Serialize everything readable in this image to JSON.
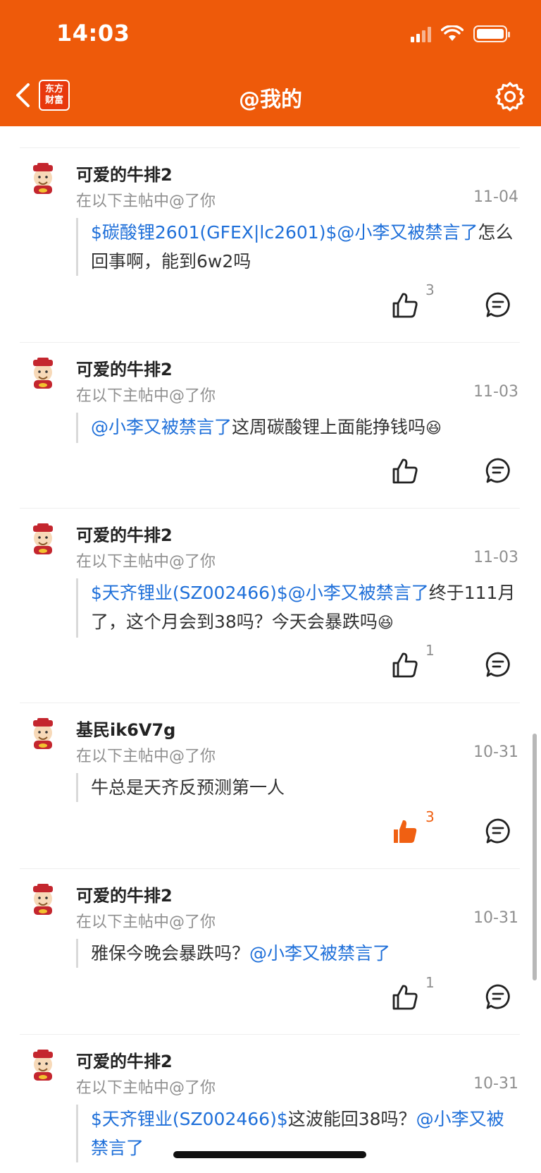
{
  "status_bar": {
    "time": "14:03"
  },
  "header": {
    "title": "@我的",
    "logo_line1": "东方",
    "logo_line2": "财富"
  },
  "colors": {
    "brand": "#EE5A0A",
    "link": "#1E6FD9",
    "like_active": "#F06012"
  },
  "items": [
    {
      "username": "可爱的牛排2",
      "subline": "在以下主帖中@了你",
      "date": "11-04",
      "link_a": "$碳酸锂2601(GFEX|lc2601)$@小李又被禁言了",
      "text_a": "怎么回事啊，能到6w2吗",
      "link_b": "",
      "text_b": "",
      "emoji": "",
      "likes": "3",
      "liked": false
    },
    {
      "username": "可爱的牛排2",
      "subline": "在以下主帖中@了你",
      "date": "11-03",
      "link_a": "@小李又被禁言了",
      "text_a": "这周碳酸锂上面能挣钱吗",
      "link_b": "",
      "text_b": "",
      "emoji": "😆",
      "likes": "",
      "liked": false
    },
    {
      "username": "可爱的牛排2",
      "subline": "在以下主帖中@了你",
      "date": "11-03",
      "link_a": "$天齐锂业(SZ002466)$@小李又被禁言了",
      "text_a": "终于111月了，这个月会到38吗？今天会暴跌吗",
      "link_b": "",
      "text_b": "",
      "emoji": "😆",
      "likes": "1",
      "liked": false
    },
    {
      "username": "基民ik6V7g",
      "subline": "在以下主帖中@了你",
      "date": "10-31",
      "link_a": "",
      "text_a": "牛总是天齐反预测第一人",
      "link_b": "",
      "text_b": "",
      "emoji": "",
      "likes": "3",
      "liked": true
    },
    {
      "username": "可爱的牛排2",
      "subline": "在以下主帖中@了你",
      "date": "10-31",
      "link_a": "",
      "text_a": "雅保今晚会暴跌吗？",
      "link_b": "@小李又被禁言了",
      "text_b": "",
      "emoji": "",
      "likes": "1",
      "liked": false
    },
    {
      "username": "可爱的牛排2",
      "subline": "在以下主帖中@了你",
      "date": "10-31",
      "link_a": "$天齐锂业(SZ002466)$",
      "text_a": "这波能回38吗？",
      "link_b": "@小李又被禁言了",
      "text_b": "",
      "emoji": "",
      "likes": "",
      "liked": false
    }
  ]
}
